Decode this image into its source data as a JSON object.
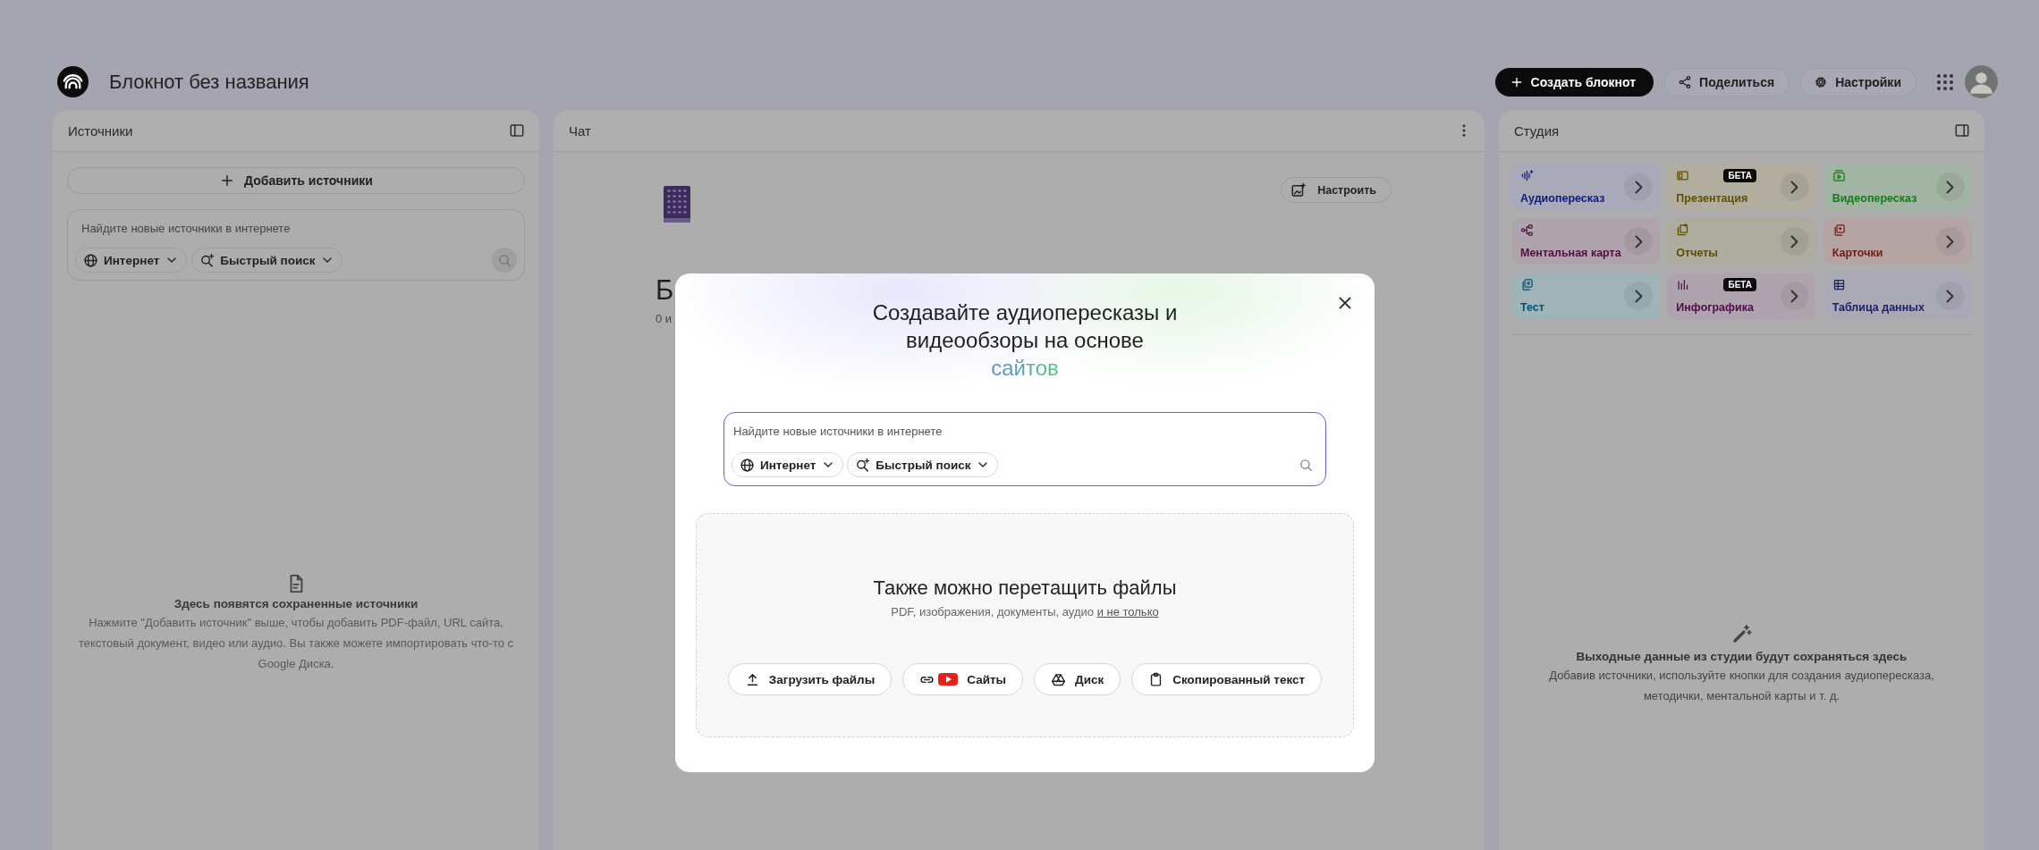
{
  "header": {
    "title": "Блокнот без названия",
    "actions": [
      {
        "label": "Создать блокнот",
        "kind": "primary"
      },
      {
        "label": "Поделиться",
        "kind": "share"
      },
      {
        "label": "Настройки",
        "kind": "settings"
      }
    ]
  },
  "sources": {
    "title": "Источники",
    "add_button": "Добавить источники",
    "search": {
      "placeholder": "Найдите новые источники в интернете",
      "chips": [
        "Интернет",
        "Быстрый поиск"
      ]
    },
    "empty": {
      "title": "Здесь появятся сохраненные источники",
      "text": "Нажмите \"Добавить источник\" выше, чтобы добавить PDF-файл, URL сайта, текстовый документ, видео или аудио. Вы также можете импортировать что-то с Google Диска."
    }
  },
  "chat": {
    "title": "Чат",
    "customize_button": "Настроить",
    "notebook_title": "Б",
    "source_count": "0 и"
  },
  "studio": {
    "title": "Студия",
    "tiles": [
      {
        "label": "Аудиопересказ",
        "color": "#a8aaba"
      },
      {
        "label": "Презентация",
        "color": "#b1ae9f",
        "badge": "БЕТА"
      },
      {
        "label": "Видеопересказ",
        "color": "#a2b4a3"
      },
      {
        "label": "Ментальная карта",
        "color": "#afa3ac"
      },
      {
        "label": "Отчеты",
        "color": "#adac9f"
      },
      {
        "label": "Карточки",
        "color": "#b4a5a4"
      },
      {
        "label": "Тест",
        "color": "#9fb3b9"
      },
      {
        "label": "Инфографика",
        "color": "#afa4ae",
        "badge": "БЕТА"
      },
      {
        "label": "Таблица данных",
        "color": "#a9aab6"
      }
    ],
    "empty": {
      "title": "Выходные данные из студии будут сохраняться здесь",
      "text": "Добавив источники, используйте кнопки для создания аудиопересказа, методички, ментальной карты и т. д."
    }
  },
  "dialog": {
    "title_lines": [
      "Создавайте аудиопересказы и",
      "видеообзоры на основе"
    ],
    "highlight": "сайтов",
    "search": {
      "placeholder": "Найдите новые источники в интернете",
      "chips": [
        "Интернет",
        "Быстрый поиск"
      ]
    },
    "drop": {
      "title": "Также можно перетащить файлы",
      "text": "PDF, изображения, документы, аудио",
      "link": "и не только"
    },
    "buttons": [
      "Загрузить файлы",
      "Сайты",
      "Диск",
      "Скопированный текст"
    ]
  }
}
